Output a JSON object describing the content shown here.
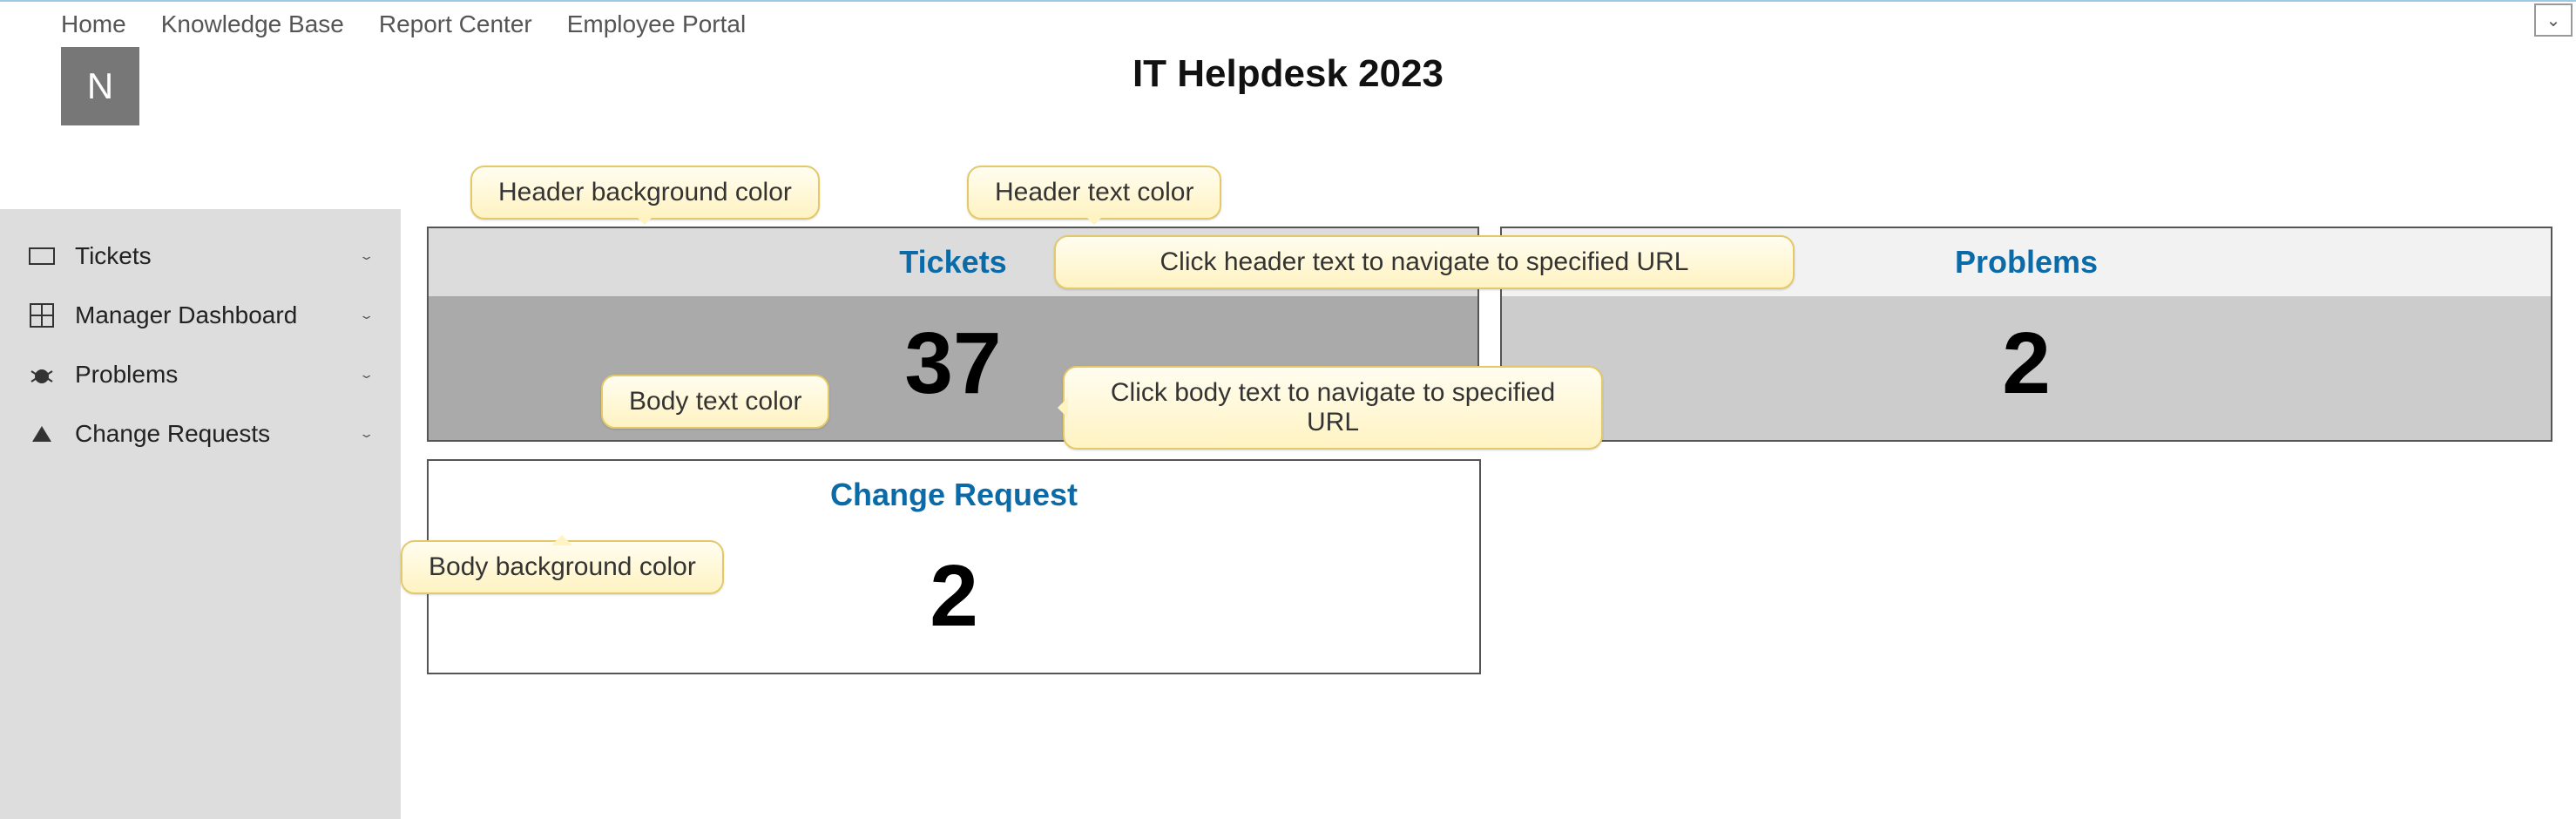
{
  "nav": {
    "items": [
      "Home",
      "Knowledge Base",
      "Report Center",
      "Employee Portal"
    ]
  },
  "avatar_initial": "N",
  "page_title": "IT Helpdesk 2023",
  "sidebar": {
    "items": [
      {
        "label": "Tickets",
        "icon": "ticket"
      },
      {
        "label": "Manager Dashboard",
        "icon": "grid"
      },
      {
        "label": "Problems",
        "icon": "bug"
      },
      {
        "label": "Change Requests",
        "icon": "triangle"
      }
    ]
  },
  "cards": [
    {
      "title": "Tickets",
      "value": "37"
    },
    {
      "title": "Problems",
      "value": "2"
    },
    {
      "title": "Change Request",
      "value": "2"
    }
  ],
  "callouts": {
    "header_bg": "Header background color",
    "header_text": "Header text color",
    "header_nav": "Click header text to navigate to specified URL",
    "body_text": "Body text color",
    "body_nav": "Click body text to navigate to specified URL",
    "body_bg": "Body background color"
  }
}
